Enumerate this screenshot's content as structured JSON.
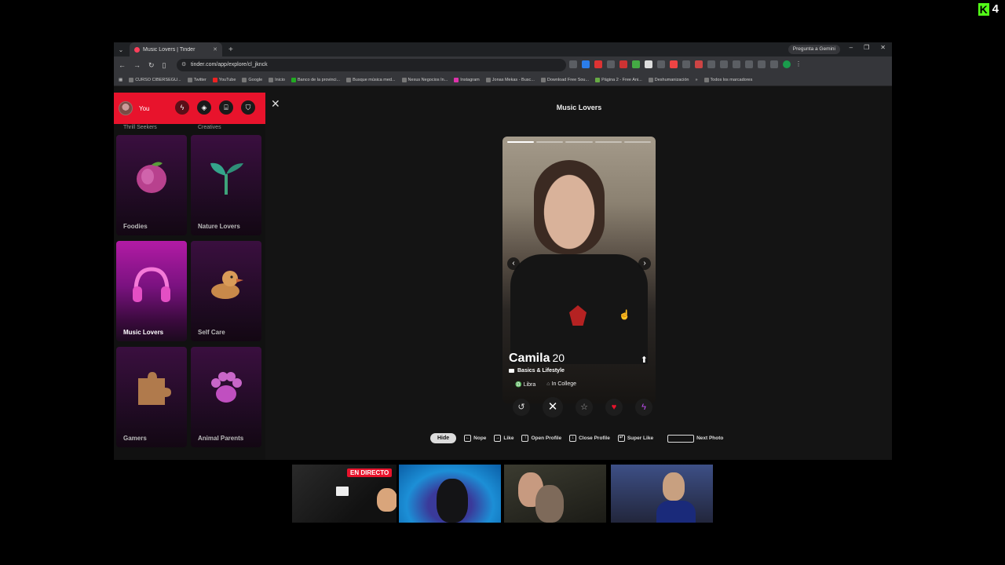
{
  "overlay": {
    "channel_count": "4"
  },
  "browser": {
    "tab_title": "Music Lovers | Tinder",
    "url": "tinder.com/app/explore/cl_jknck",
    "gemini_label": "Pregunta a Gemini",
    "bookmarks": [
      "CURSO CIBERSEGU...",
      "Twitter",
      "YouTube",
      "Google",
      "Inicio",
      "Banco de la provinci...",
      "Busque música med...",
      "Nexus Negocios In...",
      "Instagram",
      "Jonas Mekas - Busc...",
      "Download Free Sou...",
      "Página 2 - Free Ani...",
      "Deshumanización"
    ],
    "bookmarks_all": "Todos los marcadores"
  },
  "sidebar": {
    "user_label": "You",
    "top_labels": [
      "Thrill Seekers",
      "Creatives"
    ],
    "categories": [
      {
        "name": "Foodies",
        "icon": "peach-icon"
      },
      {
        "name": "Nature Lovers",
        "icon": "sprout-icon"
      },
      {
        "name": "Music Lovers",
        "icon": "headphones-icon",
        "selected": true
      },
      {
        "name": "Self Care",
        "icon": "rubber-duck-icon"
      },
      {
        "name": "Gamers",
        "icon": "puzzle-icon"
      },
      {
        "name": "Animal Parents",
        "icon": "paw-icon"
      }
    ]
  },
  "main": {
    "title": "Music Lovers",
    "profile": {
      "name": "Camila",
      "age": "20",
      "badge": "Basics & Lifestyle",
      "tags": [
        "Libra",
        "In College"
      ]
    },
    "shortcuts": {
      "hide": "Hide",
      "nope": "Nope",
      "like": "Like",
      "open_profile": "Open Profile",
      "close_profile": "Close Profile",
      "super_like": "Super Like",
      "next_photo": "Next Photo"
    }
  },
  "stream": {
    "live_label": "EN DIRECTO"
  },
  "colors": {
    "tinder_red": "#e8132c",
    "kick_green": "#53fc18",
    "category_purple": "#b21ba5"
  }
}
